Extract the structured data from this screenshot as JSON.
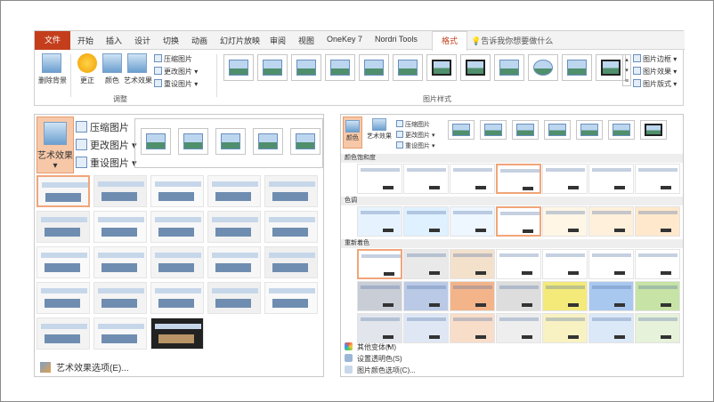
{
  "ribbon": {
    "tabs": [
      "文件",
      "开始",
      "插入",
      "设计",
      "切换",
      "动画",
      "幻灯片放映",
      "审阅",
      "视图",
      "OneKey 7",
      "Nordri Tools",
      "格式"
    ],
    "active_tab": "格式",
    "tell_me": "告诉我你想要做什么",
    "adjust": {
      "remove_bg": "删除背景",
      "correct": "更正",
      "color": "颜色",
      "art_effects": "艺术效果",
      "compress": "压缩图片",
      "change": "更改图片",
      "reset": "重设图片",
      "group_label": "调整"
    },
    "styles": {
      "group_label": "图片样式",
      "border": "图片边框",
      "effects": "图片效果",
      "layout": "图片版式"
    }
  },
  "left_panel": {
    "art_effects": "艺术效果",
    "compress": "压缩图片",
    "change": "更改图片",
    "reset": "重设图片",
    "options": "艺术效果选项(E)..."
  },
  "right_panel": {
    "color": "颜色",
    "art_effects": "艺术效果",
    "compress": "压缩图片",
    "change": "更改图片",
    "reset": "重设图片",
    "sections": [
      "颜色饱和度",
      "色调",
      "重新着色"
    ],
    "more_variations": "其他变体(M)",
    "set_transparent": "设置透明色(S)",
    "color_options": "图片颜色选项(C)..."
  },
  "colors": {
    "file_tab": "#c43e1c",
    "selected_highlight": "#f7c8a8",
    "selected_border": "#f1a57a"
  }
}
